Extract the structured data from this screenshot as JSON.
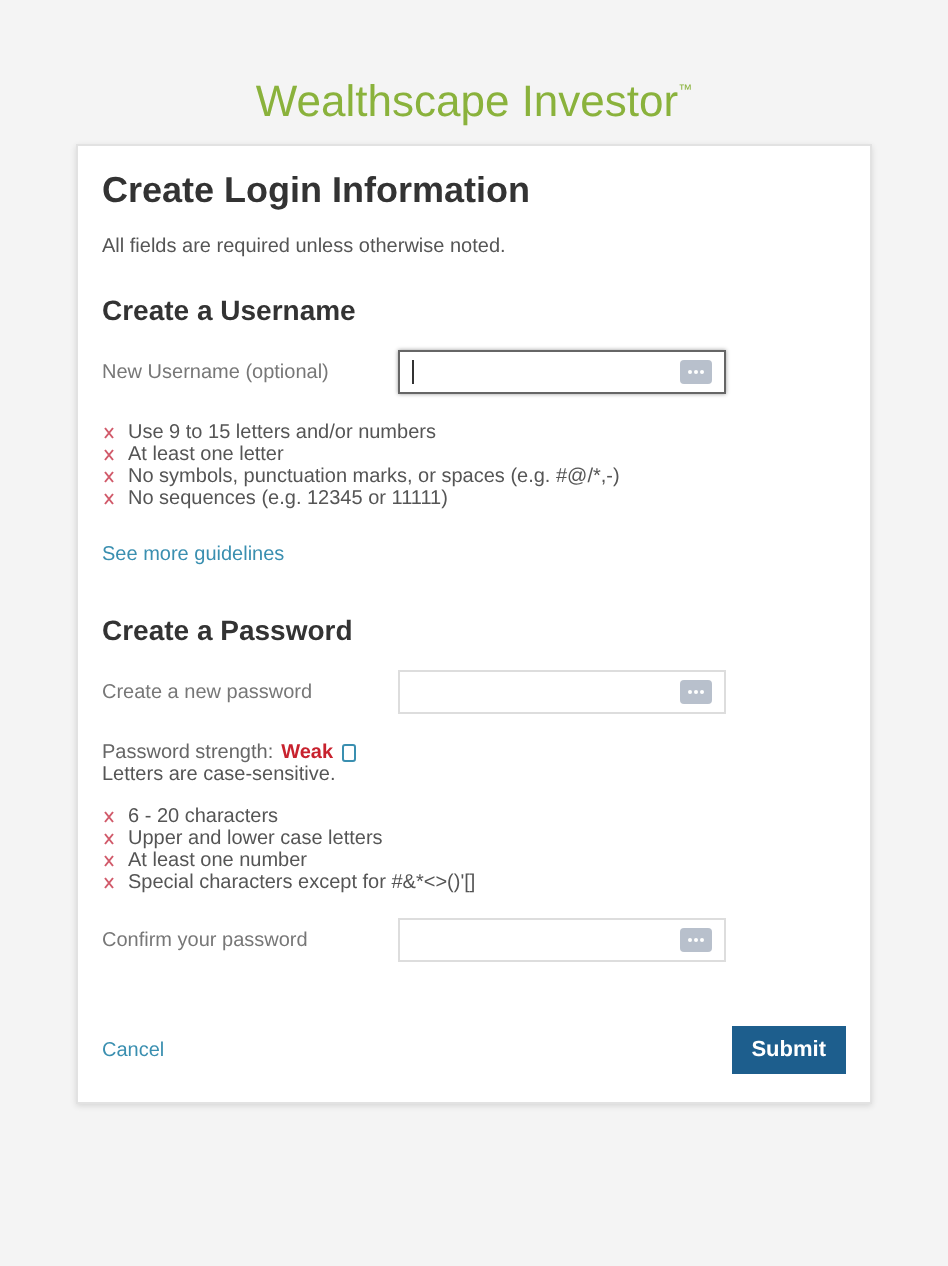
{
  "brand": {
    "name": "Wealthscape Investor",
    "mark": "™"
  },
  "title": "Create Login Information",
  "note": "All fields are required unless otherwise noted.",
  "username": {
    "heading": "Create a Username",
    "field": {
      "label": "New Username (optional)",
      "focused": true
    },
    "rules": [
      {
        "text": "Use 9 to 15 letters and/or numbers",
        "met": false
      },
      {
        "text": "At least one letter",
        "met": false
      },
      {
        "text": "No symbols, punctuation marks, or spaces (e.g. #@/*,-)",
        "met": false
      },
      {
        "text": "No sequences (e.g. 12345 or 11111)",
        "met": false
      }
    ],
    "link": "See more guidelines"
  },
  "password": {
    "heading": "Create a Password",
    "field": {
      "label": "Create a new password",
      "focused": false
    },
    "strength_label": "Password strength:",
    "strength": "Weak",
    "case_note": "Letters are case-sensitive.",
    "rules": [
      {
        "text": "6 - 20 characters",
        "met": false
      },
      {
        "text": "Upper and lower case letters",
        "met": false
      },
      {
        "text": "At least one number",
        "met": false
      },
      {
        "text": "Special characters except for #&*<>()'[]",
        "met": false
      }
    ],
    "confirm": {
      "label": "Confirm your password",
      "focused": false
    }
  },
  "cancel": "Cancel",
  "submit": "Submit"
}
